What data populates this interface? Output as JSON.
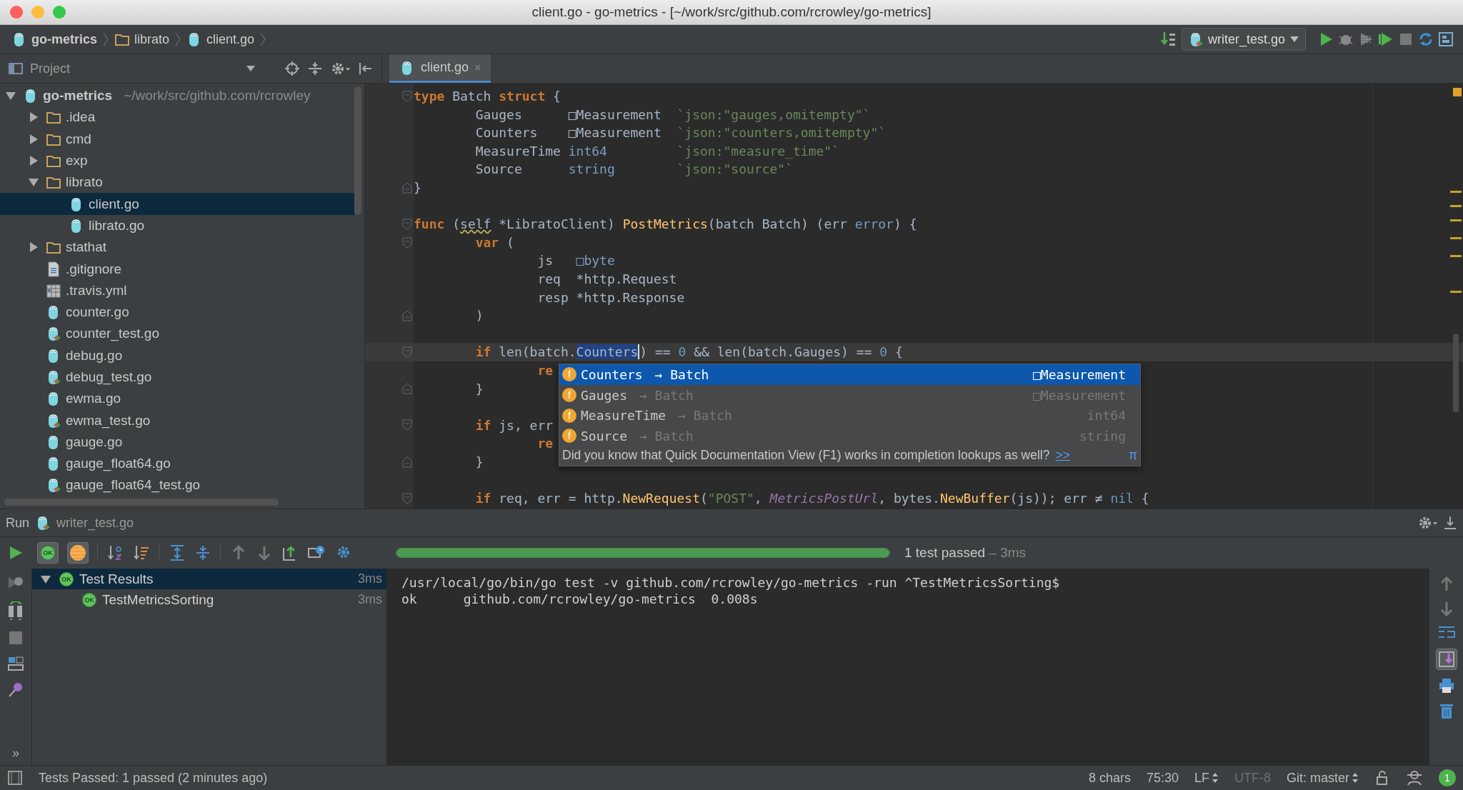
{
  "window": {
    "title": "client.go - go-metrics - [~/work/src/github.com/rcrowley/go-metrics]"
  },
  "breadcrumbs": [
    {
      "label": "go-metrics",
      "kind": "module"
    },
    {
      "label": "librato",
      "kind": "folder"
    },
    {
      "label": "client.go",
      "kind": "go"
    }
  ],
  "run_config": {
    "label": "writer_test.go"
  },
  "project_panel": {
    "title": "Project",
    "tree": [
      {
        "label": "go-metrics",
        "path": "~/work/src/github.com/rcrowley",
        "kind": "module",
        "expanded": true,
        "selected": false,
        "children": [
          {
            "label": ".idea",
            "kind": "folder",
            "expanded": false,
            "selected": false
          },
          {
            "label": "cmd",
            "kind": "folder",
            "expanded": false,
            "selected": false
          },
          {
            "label": "exp",
            "kind": "folder",
            "expanded": false,
            "selected": false
          },
          {
            "label": "librato",
            "kind": "folder",
            "expanded": true,
            "selected": false,
            "children": [
              {
                "label": "client.go",
                "kind": "go",
                "selected": true
              },
              {
                "label": "librato.go",
                "kind": "go",
                "selected": false
              }
            ]
          },
          {
            "label": "stathat",
            "kind": "folder",
            "expanded": false,
            "selected": false
          },
          {
            "label": ".gitignore",
            "kind": "text",
            "selected": false
          },
          {
            "label": ".travis.yml",
            "kind": "yml",
            "selected": false
          },
          {
            "label": "counter.go",
            "kind": "go",
            "selected": false
          },
          {
            "label": "counter_test.go",
            "kind": "go-test",
            "selected": false
          },
          {
            "label": "debug.go",
            "kind": "go",
            "selected": false
          },
          {
            "label": "debug_test.go",
            "kind": "go-test",
            "selected": false
          },
          {
            "label": "ewma.go",
            "kind": "go",
            "selected": false
          },
          {
            "label": "ewma_test.go",
            "kind": "go-test",
            "selected": false
          },
          {
            "label": "gauge.go",
            "kind": "go",
            "selected": false
          },
          {
            "label": "gauge_float64.go",
            "kind": "go",
            "selected": false
          },
          {
            "label": "gauge_float64_test.go",
            "kind": "go-test",
            "selected": false
          }
        ]
      }
    ]
  },
  "editor_tabs": [
    {
      "label": "client.go",
      "close": "×",
      "selected": true
    }
  ],
  "code_lines": [
    {
      "fold_start": true,
      "fold_end": false,
      "current": false,
      "tokens": [
        {
          "kind": "kw",
          "text": "type"
        },
        {
          "kind": "plain",
          "text": " Batch "
        },
        {
          "kind": "kw",
          "text": "struct"
        },
        {
          "kind": "plain",
          "text": " {"
        }
      ]
    },
    {
      "fold_start": false,
      "fold_end": false,
      "current": false,
      "tokens": [
        {
          "kind": "plain",
          "text": "        Gauges      □Measurement  "
        },
        {
          "kind": "str",
          "text": "`json:\"gauges,omitempty\"`"
        }
      ]
    },
    {
      "fold_start": false,
      "fold_end": false,
      "current": false,
      "tokens": [
        {
          "kind": "plain",
          "text": "        Counters    □Measurement  "
        },
        {
          "kind": "str",
          "text": "`json:\"counters,omitempty\"`"
        }
      ]
    },
    {
      "fold_start": false,
      "fold_end": false,
      "current": false,
      "tokens": [
        {
          "kind": "plain",
          "text": "        MeasureTime "
        },
        {
          "kind": "type",
          "text": "int64"
        },
        {
          "kind": "str",
          "text": "         `json:\"measure_time\"`"
        }
      ]
    },
    {
      "fold_start": false,
      "fold_end": false,
      "current": false,
      "tokens": [
        {
          "kind": "plain",
          "text": "        Source      "
        },
        {
          "kind": "type",
          "text": "string"
        },
        {
          "kind": "str",
          "text": "        `json:\"source\"`"
        }
      ]
    },
    {
      "fold_start": false,
      "fold_end": true,
      "current": false,
      "tokens": [
        {
          "kind": "plain",
          "text": "}"
        }
      ]
    },
    {
      "fold_start": false,
      "fold_end": false,
      "current": false
    },
    {
      "fold_start": true,
      "fold_end": false,
      "current": false,
      "tokens": [
        {
          "kind": "kw",
          "text": "func"
        },
        {
          "kind": "plain",
          "text": " ("
        },
        {
          "kind": "warning",
          "text": "self"
        },
        {
          "kind": "plain",
          "text": " *LibratoClient) "
        },
        {
          "kind": "fn",
          "text": "PostMetrics"
        },
        {
          "kind": "plain",
          "text": "(batch Batch) (err "
        },
        {
          "kind": "type",
          "text": "error"
        },
        {
          "kind": "plain",
          "text": ") {"
        }
      ]
    },
    {
      "fold_start": true,
      "fold_end": false,
      "current": false,
      "tokens": [
        {
          "kind": "kw",
          "text": "        var"
        },
        {
          "kind": "plain",
          "text": " ("
        }
      ]
    },
    {
      "fold_start": false,
      "fold_end": false,
      "current": false,
      "tokens": [
        {
          "kind": "plain",
          "text": "                js   "
        },
        {
          "kind": "type",
          "text": "□byte"
        }
      ]
    },
    {
      "fold_start": false,
      "fold_end": false,
      "current": false,
      "tokens": [
        {
          "kind": "plain",
          "text": "                req  *http.Request"
        }
      ]
    },
    {
      "fold_start": false,
      "fold_end": false,
      "current": false,
      "tokens": [
        {
          "kind": "plain",
          "text": "                resp *http.Response"
        }
      ]
    },
    {
      "fold_start": false,
      "fold_end": true,
      "current": false,
      "tokens": [
        {
          "kind": "plain",
          "text": "        )"
        }
      ]
    },
    {
      "fold_start": false,
      "fold_end": false,
      "current": false
    },
    {
      "fold_start": true,
      "fold_end": false,
      "current": true,
      "tokens": [
        {
          "kind": "kw",
          "text": "        if"
        },
        {
          "kind": "plain",
          "text": " len(batch."
        },
        {
          "kind": "selection",
          "text": "Counters"
        },
        {
          "kind": "plain",
          "text": ") == "
        },
        {
          "kind": "num",
          "text": "0"
        },
        {
          "kind": "plain",
          "text": " && len(batch.Gauges) == "
        },
        {
          "kind": "num",
          "text": "0"
        },
        {
          "kind": "plain",
          "text": " {"
        }
      ]
    },
    {
      "fold_start": false,
      "fold_end": false,
      "current": false,
      "tokens": [
        {
          "kind": "kw",
          "text": "                re"
        }
      ]
    },
    {
      "fold_start": false,
      "fold_end": true,
      "current": false,
      "tokens": [
        {
          "kind": "plain",
          "text": "        }"
        }
      ]
    },
    {
      "fold_start": false,
      "fold_end": false,
      "current": false
    },
    {
      "fold_start": true,
      "fold_end": false,
      "current": false,
      "tokens": [
        {
          "kind": "kw",
          "text": "        if"
        },
        {
          "kind": "plain",
          "text": " js, err"
        }
      ]
    },
    {
      "fold_start": false,
      "fold_end": false,
      "current": false,
      "tokens": [
        {
          "kind": "kw",
          "text": "                re"
        }
      ]
    },
    {
      "fold_start": false,
      "fold_end": true,
      "current": false,
      "tokens": [
        {
          "kind": "plain",
          "text": "        }"
        }
      ]
    },
    {
      "fold_start": false,
      "fold_end": false,
      "current": false
    },
    {
      "fold_start": true,
      "fold_end": false,
      "current": false,
      "tokens": [
        {
          "kind": "kw",
          "text": "        if"
        },
        {
          "kind": "plain",
          "text": " req, err = http."
        },
        {
          "kind": "fn",
          "text": "NewRequest"
        },
        {
          "kind": "plain",
          "text": "("
        },
        {
          "kind": "str",
          "text": "\"POST\""
        },
        {
          "kind": "plain",
          "text": ", "
        },
        {
          "kind": "const",
          "text": "MetricsPostUrl"
        },
        {
          "kind": "plain",
          "text": ", bytes."
        },
        {
          "kind": "fn",
          "text": "NewBuffer"
        },
        {
          "kind": "plain",
          "text": "(js)); err ≠ "
        },
        {
          "kind": "num",
          "text": "nil"
        },
        {
          "kind": "plain",
          "text": " {"
        }
      ]
    }
  ],
  "completion": {
    "items": [
      {
        "icon": "f",
        "name": "Counters",
        "arrow": "→",
        "owner": "Batch",
        "type": "□Measurement",
        "selected": true
      },
      {
        "icon": "f",
        "name": "Gauges",
        "arrow": "→",
        "owner": "Batch",
        "type": "□Measurement",
        "selected": false
      },
      {
        "icon": "f",
        "name": "MeasureTime",
        "arrow": "→",
        "owner": "Batch",
        "type": "int64",
        "selected": false
      },
      {
        "icon": "f",
        "name": "Source",
        "arrow": "→",
        "owner": "Batch",
        "type": "string",
        "selected": false
      }
    ],
    "hint": "Did you know that Quick Documentation View (F1) works in completion lookups as well?",
    "hint_link": ">>",
    "pi": "π"
  },
  "run_panel": {
    "title": "Run",
    "config": "writer_test.go",
    "filters": [
      {
        "kind": "passed",
        "badge": "OK",
        "on": true
      },
      {
        "kind": "ignored",
        "on": true
      }
    ],
    "progress": {
      "level": 1
    },
    "summary": "1 test passed",
    "duration": "– 3ms",
    "tests": [
      {
        "label": "Test Results",
        "badge": "OK",
        "time": "3ms",
        "expanded": true,
        "selected": true,
        "children": [
          {
            "label": "TestMetricsSorting",
            "badge": "OK",
            "time": "3ms",
            "selected": false
          }
        ]
      }
    ],
    "console": [
      "/usr/local/go/bin/go test -v github.com/rcrowley/go-metrics -run ^TestMetricsSorting$",
      "ok      github.com/rcrowley/go-metrics  0.008s"
    ],
    "more": "»"
  },
  "status_bar": {
    "message": "Tests Passed: 1 passed (2 minutes ago)",
    "items": [
      {
        "label": "8 chars",
        "dropdown": false,
        "disabled": false
      },
      {
        "label": "75:30",
        "dropdown": false,
        "disabled": false
      },
      {
        "label": "LF",
        "dropdown": true,
        "disabled": false
      },
      {
        "label": "UTF-8",
        "dropdown": false,
        "disabled": true
      },
      {
        "label": "Git: master",
        "dropdown": true,
        "disabled": false
      }
    ],
    "notifications": "1"
  }
}
